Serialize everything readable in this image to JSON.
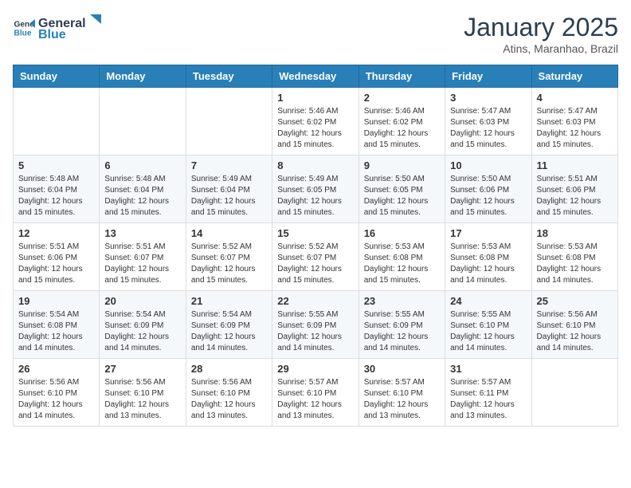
{
  "logo": {
    "line1": "General",
    "line2": "Blue"
  },
  "title": "January 2025",
  "subtitle": "Atins, Maranhao, Brazil",
  "weekdays": [
    "Sunday",
    "Monday",
    "Tuesday",
    "Wednesday",
    "Thursday",
    "Friday",
    "Saturday"
  ],
  "weeks": [
    [
      {
        "day": "",
        "info": ""
      },
      {
        "day": "",
        "info": ""
      },
      {
        "day": "",
        "info": ""
      },
      {
        "day": "1",
        "info": "Sunrise: 5:46 AM\nSunset: 6:02 PM\nDaylight: 12 hours\nand 15 minutes."
      },
      {
        "day": "2",
        "info": "Sunrise: 5:46 AM\nSunset: 6:02 PM\nDaylight: 12 hours\nand 15 minutes."
      },
      {
        "day": "3",
        "info": "Sunrise: 5:47 AM\nSunset: 6:03 PM\nDaylight: 12 hours\nand 15 minutes."
      },
      {
        "day": "4",
        "info": "Sunrise: 5:47 AM\nSunset: 6:03 PM\nDaylight: 12 hours\nand 15 minutes."
      }
    ],
    [
      {
        "day": "5",
        "info": "Sunrise: 5:48 AM\nSunset: 6:04 PM\nDaylight: 12 hours\nand 15 minutes."
      },
      {
        "day": "6",
        "info": "Sunrise: 5:48 AM\nSunset: 6:04 PM\nDaylight: 12 hours\nand 15 minutes."
      },
      {
        "day": "7",
        "info": "Sunrise: 5:49 AM\nSunset: 6:04 PM\nDaylight: 12 hours\nand 15 minutes."
      },
      {
        "day": "8",
        "info": "Sunrise: 5:49 AM\nSunset: 6:05 PM\nDaylight: 12 hours\nand 15 minutes."
      },
      {
        "day": "9",
        "info": "Sunrise: 5:50 AM\nSunset: 6:05 PM\nDaylight: 12 hours\nand 15 minutes."
      },
      {
        "day": "10",
        "info": "Sunrise: 5:50 AM\nSunset: 6:06 PM\nDaylight: 12 hours\nand 15 minutes."
      },
      {
        "day": "11",
        "info": "Sunrise: 5:51 AM\nSunset: 6:06 PM\nDaylight: 12 hours\nand 15 minutes."
      }
    ],
    [
      {
        "day": "12",
        "info": "Sunrise: 5:51 AM\nSunset: 6:06 PM\nDaylight: 12 hours\nand 15 minutes."
      },
      {
        "day": "13",
        "info": "Sunrise: 5:51 AM\nSunset: 6:07 PM\nDaylight: 12 hours\nand 15 minutes."
      },
      {
        "day": "14",
        "info": "Sunrise: 5:52 AM\nSunset: 6:07 PM\nDaylight: 12 hours\nand 15 minutes."
      },
      {
        "day": "15",
        "info": "Sunrise: 5:52 AM\nSunset: 6:07 PM\nDaylight: 12 hours\nand 15 minutes."
      },
      {
        "day": "16",
        "info": "Sunrise: 5:53 AM\nSunset: 6:08 PM\nDaylight: 12 hours\nand 15 minutes."
      },
      {
        "day": "17",
        "info": "Sunrise: 5:53 AM\nSunset: 6:08 PM\nDaylight: 12 hours\nand 14 minutes."
      },
      {
        "day": "18",
        "info": "Sunrise: 5:53 AM\nSunset: 6:08 PM\nDaylight: 12 hours\nand 14 minutes."
      }
    ],
    [
      {
        "day": "19",
        "info": "Sunrise: 5:54 AM\nSunset: 6:08 PM\nDaylight: 12 hours\nand 14 minutes."
      },
      {
        "day": "20",
        "info": "Sunrise: 5:54 AM\nSunset: 6:09 PM\nDaylight: 12 hours\nand 14 minutes."
      },
      {
        "day": "21",
        "info": "Sunrise: 5:54 AM\nSunset: 6:09 PM\nDaylight: 12 hours\nand 14 minutes."
      },
      {
        "day": "22",
        "info": "Sunrise: 5:55 AM\nSunset: 6:09 PM\nDaylight: 12 hours\nand 14 minutes."
      },
      {
        "day": "23",
        "info": "Sunrise: 5:55 AM\nSunset: 6:09 PM\nDaylight: 12 hours\nand 14 minutes."
      },
      {
        "day": "24",
        "info": "Sunrise: 5:55 AM\nSunset: 6:10 PM\nDaylight: 12 hours\nand 14 minutes."
      },
      {
        "day": "25",
        "info": "Sunrise: 5:56 AM\nSunset: 6:10 PM\nDaylight: 12 hours\nand 14 minutes."
      }
    ],
    [
      {
        "day": "26",
        "info": "Sunrise: 5:56 AM\nSunset: 6:10 PM\nDaylight: 12 hours\nand 14 minutes."
      },
      {
        "day": "27",
        "info": "Sunrise: 5:56 AM\nSunset: 6:10 PM\nDaylight: 12 hours\nand 13 minutes."
      },
      {
        "day": "28",
        "info": "Sunrise: 5:56 AM\nSunset: 6:10 PM\nDaylight: 12 hours\nand 13 minutes."
      },
      {
        "day": "29",
        "info": "Sunrise: 5:57 AM\nSunset: 6:10 PM\nDaylight: 12 hours\nand 13 minutes."
      },
      {
        "day": "30",
        "info": "Sunrise: 5:57 AM\nSunset: 6:10 PM\nDaylight: 12 hours\nand 13 minutes."
      },
      {
        "day": "31",
        "info": "Sunrise: 5:57 AM\nSunset: 6:11 PM\nDaylight: 12 hours\nand 13 minutes."
      },
      {
        "day": "",
        "info": ""
      }
    ]
  ]
}
